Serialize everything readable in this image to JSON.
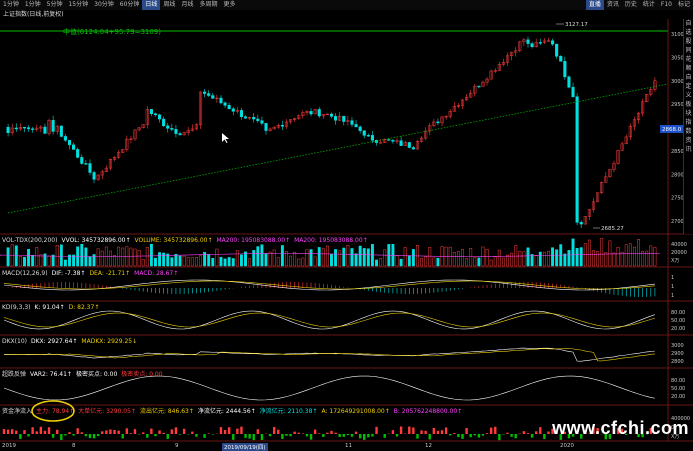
{
  "toolbar": {
    "periods": [
      "1分钟",
      "1分钟",
      "5分钟",
      "15分钟",
      "30分钟",
      "60分钟",
      "日线",
      "周线",
      "月线",
      "多周期",
      "更多"
    ],
    "active_index": 6,
    "right_items": [
      "直播",
      "资讯",
      "历史",
      "统计",
      "F10",
      "标记"
    ]
  },
  "title": "上证指数(日线,前复权)",
  "annotation": "中值(6124.04+95.79=3109)",
  "price_labels": {
    "high": "3127.17",
    "low": "2685.27",
    "current": "2868.0"
  },
  "price_axis": [
    "3100",
    "3050",
    "3000",
    "2950",
    "2900",
    "2850",
    "2800",
    "2750",
    "2700"
  ],
  "sidebar": [
    "自",
    "选",
    "股",
    "同",
    "花",
    "顺",
    "自",
    "定",
    "义",
    "板",
    "块",
    "指",
    "数",
    "资",
    "讯"
  ],
  "vol": {
    "name": "VOL-TDX(200,200)",
    "vvol": "VVOL: 345732896.00↑",
    "volume": "VOLUME: 345732896.00↑",
    "ma200": "MA200: 195083088.00↑",
    "ma200b": "MA200: 195083088.00↑",
    "axis": [
      "40000",
      "20000",
      "X万"
    ]
  },
  "macd": {
    "name": "MACD(12,26,9)",
    "dif": "DIF: -7.38↑",
    "dea": "DEA: -21.71↑",
    "macd": "MACD: 28.67↑",
    "axis": [
      "1",
      "1",
      "1"
    ]
  },
  "kd": {
    "name": "KD(9,3,3)",
    "k": "K: 91.04↑",
    "d": "D: 82.37↑",
    "axis": [
      "80.00",
      "50.00",
      "20.00"
    ]
  },
  "dkx": {
    "name": "DKX(10)",
    "dkx": "DKX: 2927.64↑",
    "madkx": "MADKX: 2929.25↓",
    "axis": [
      "3000",
      "2900",
      "2800"
    ]
  },
  "reversal": {
    "name": "超跌反弹",
    "var2": "VAR2: 76.41↑",
    "signal": "极密买点: 0.00",
    "sell": "极密卖点: 0.00",
    "axis": [
      "80.00",
      "50.00",
      "20.00"
    ]
  },
  "money": {
    "name": "资金净流入",
    "main": "主力: 78.94↑",
    "super": "大单亿元: 3290.05↑",
    "out": "流出亿元: 846.63↑",
    "net": "净流亿元: 2444.56↑",
    "net2": "净流亿元: 2110.38↑",
    "a": "A: 172649291008.00↑",
    "b": "B: 205762248800.00↑",
    "axis": [
      "400000",
      "0",
      "X万"
    ]
  },
  "xaxis": {
    "labels": [
      "2019",
      "8",
      "9",
      "10",
      "11",
      "12",
      "2020"
    ],
    "highlight": "2019/09/19(四)"
  },
  "watermark": "www.cfchi.com",
  "colors": {
    "up": "#ff3b3b",
    "down": "#00e0e0",
    "white": "#ffffff",
    "yellow": "#f0d000",
    "magenta": "#ff40ff",
    "green": "#00c000"
  }
}
